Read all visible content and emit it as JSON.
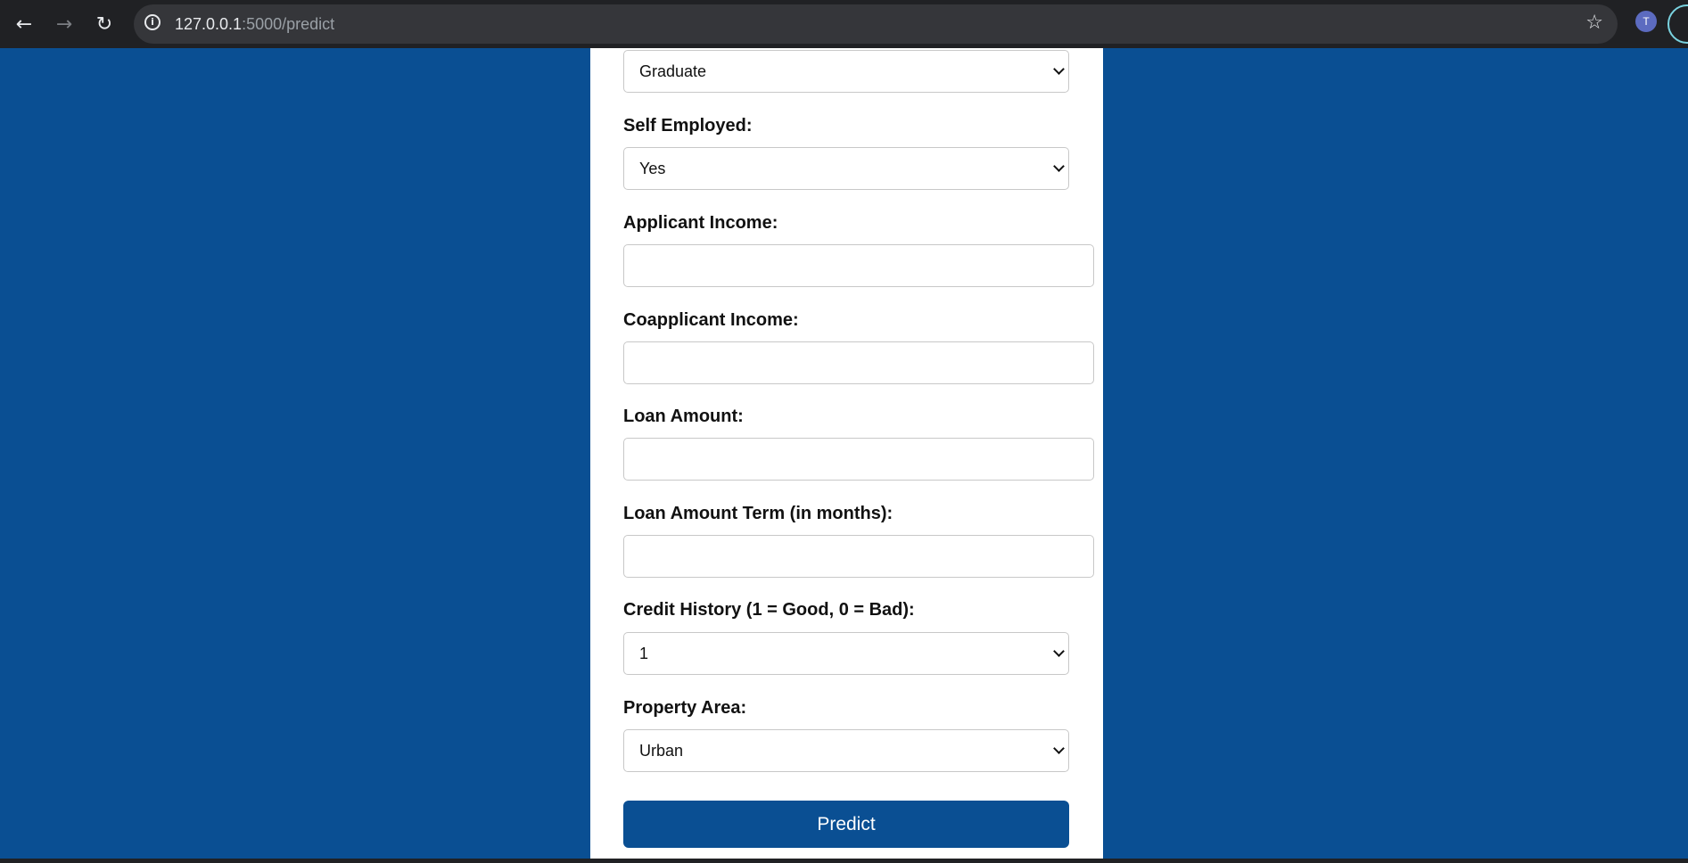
{
  "browser": {
    "url_host": "127.0.0.1",
    "url_rest": ":5000/predict",
    "profile_initial": "T",
    "icons": {
      "back": "back-arrow-icon",
      "forward": "forward-arrow-icon",
      "reload": "reload-icon",
      "info": "info-icon",
      "star": "star-icon",
      "menu": "kebab-menu-icon"
    }
  },
  "form": {
    "education": {
      "value": "Graduate"
    },
    "self_employed": {
      "label": "Self Employed:",
      "value": "Yes"
    },
    "applicant_income": {
      "label": "Applicant Income:",
      "value": ""
    },
    "coapplicant_income": {
      "label": "Coapplicant Income:",
      "value": ""
    },
    "loan_amount": {
      "label": "Loan Amount:",
      "value": ""
    },
    "loan_term": {
      "label": "Loan Amount Term (in months):",
      "value": ""
    },
    "credit_history": {
      "label": "Credit History (1 = Good, 0 = Bad):",
      "value": "1"
    },
    "property_area": {
      "label": "Property Area:",
      "value": "Urban"
    },
    "submit_label": "Predict"
  },
  "colors": {
    "page_background": "#0a4f93",
    "button_background": "#0a4f93",
    "card_background": "#ffffff",
    "chrome_background": "#202124"
  }
}
